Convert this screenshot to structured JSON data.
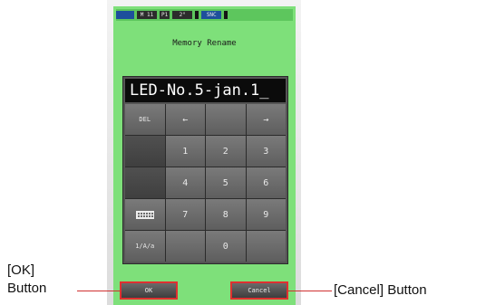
{
  "status_bar": {
    "items": [
      "",
      "M 11",
      "P1",
      "2°",
      "",
      "SNC",
      ""
    ]
  },
  "screen_title": "Memory Rename",
  "name_field": {
    "value": "LED-No.5-jan.1_"
  },
  "keypad": {
    "rows": [
      [
        "DEL",
        "←",
        "",
        "→"
      ],
      [
        "",
        "1",
        "2",
        "3"
      ],
      [
        "",
        "4",
        "5",
        "6"
      ],
      [
        "",
        "7",
        "8",
        "9"
      ],
      [
        "1/A/a",
        "",
        "0",
        ""
      ]
    ]
  },
  "buttons": {
    "ok": "OK",
    "cancel": "Cancel"
  },
  "callouts": {
    "ok_line1": "[OK]",
    "ok_line2": "Button",
    "cancel": "[Cancel] Button"
  },
  "colors": {
    "screen_bg": "#7ee07a",
    "highlight": "#e03030"
  },
  "icons": {
    "keyboard_key": "keyboard-icon"
  }
}
